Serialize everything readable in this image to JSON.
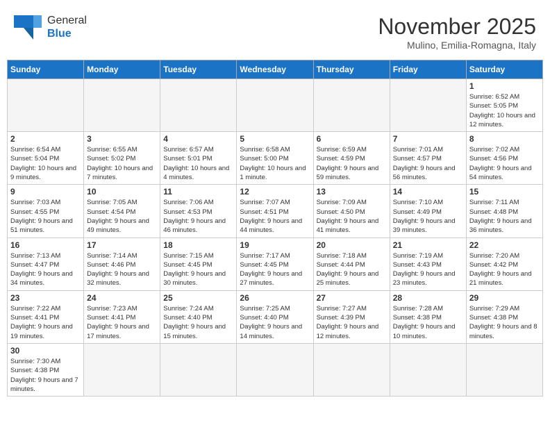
{
  "header": {
    "logo_line1": "General",
    "logo_line2": "Blue",
    "month": "November 2025",
    "location": "Mulino, Emilia-Romagna, Italy"
  },
  "weekdays": [
    "Sunday",
    "Monday",
    "Tuesday",
    "Wednesday",
    "Thursday",
    "Friday",
    "Saturday"
  ],
  "weeks": [
    [
      {
        "day": "",
        "info": ""
      },
      {
        "day": "",
        "info": ""
      },
      {
        "day": "",
        "info": ""
      },
      {
        "day": "",
        "info": ""
      },
      {
        "day": "",
        "info": ""
      },
      {
        "day": "",
        "info": ""
      },
      {
        "day": "1",
        "info": "Sunrise: 6:52 AM\nSunset: 5:05 PM\nDaylight: 10 hours and 12 minutes."
      }
    ],
    [
      {
        "day": "2",
        "info": "Sunrise: 6:54 AM\nSunset: 5:04 PM\nDaylight: 10 hours and 9 minutes."
      },
      {
        "day": "3",
        "info": "Sunrise: 6:55 AM\nSunset: 5:02 PM\nDaylight: 10 hours and 7 minutes."
      },
      {
        "day": "4",
        "info": "Sunrise: 6:57 AM\nSunset: 5:01 PM\nDaylight: 10 hours and 4 minutes."
      },
      {
        "day": "5",
        "info": "Sunrise: 6:58 AM\nSunset: 5:00 PM\nDaylight: 10 hours and 1 minute."
      },
      {
        "day": "6",
        "info": "Sunrise: 6:59 AM\nSunset: 4:59 PM\nDaylight: 9 hours and 59 minutes."
      },
      {
        "day": "7",
        "info": "Sunrise: 7:01 AM\nSunset: 4:57 PM\nDaylight: 9 hours and 56 minutes."
      },
      {
        "day": "8",
        "info": "Sunrise: 7:02 AM\nSunset: 4:56 PM\nDaylight: 9 hours and 54 minutes."
      }
    ],
    [
      {
        "day": "9",
        "info": "Sunrise: 7:03 AM\nSunset: 4:55 PM\nDaylight: 9 hours and 51 minutes."
      },
      {
        "day": "10",
        "info": "Sunrise: 7:05 AM\nSunset: 4:54 PM\nDaylight: 9 hours and 49 minutes."
      },
      {
        "day": "11",
        "info": "Sunrise: 7:06 AM\nSunset: 4:53 PM\nDaylight: 9 hours and 46 minutes."
      },
      {
        "day": "12",
        "info": "Sunrise: 7:07 AM\nSunset: 4:51 PM\nDaylight: 9 hours and 44 minutes."
      },
      {
        "day": "13",
        "info": "Sunrise: 7:09 AM\nSunset: 4:50 PM\nDaylight: 9 hours and 41 minutes."
      },
      {
        "day": "14",
        "info": "Sunrise: 7:10 AM\nSunset: 4:49 PM\nDaylight: 9 hours and 39 minutes."
      },
      {
        "day": "15",
        "info": "Sunrise: 7:11 AM\nSunset: 4:48 PM\nDaylight: 9 hours and 36 minutes."
      }
    ],
    [
      {
        "day": "16",
        "info": "Sunrise: 7:13 AM\nSunset: 4:47 PM\nDaylight: 9 hours and 34 minutes."
      },
      {
        "day": "17",
        "info": "Sunrise: 7:14 AM\nSunset: 4:46 PM\nDaylight: 9 hours and 32 minutes."
      },
      {
        "day": "18",
        "info": "Sunrise: 7:15 AM\nSunset: 4:45 PM\nDaylight: 9 hours and 30 minutes."
      },
      {
        "day": "19",
        "info": "Sunrise: 7:17 AM\nSunset: 4:45 PM\nDaylight: 9 hours and 27 minutes."
      },
      {
        "day": "20",
        "info": "Sunrise: 7:18 AM\nSunset: 4:44 PM\nDaylight: 9 hours and 25 minutes."
      },
      {
        "day": "21",
        "info": "Sunrise: 7:19 AM\nSunset: 4:43 PM\nDaylight: 9 hours and 23 minutes."
      },
      {
        "day": "22",
        "info": "Sunrise: 7:20 AM\nSunset: 4:42 PM\nDaylight: 9 hours and 21 minutes."
      }
    ],
    [
      {
        "day": "23",
        "info": "Sunrise: 7:22 AM\nSunset: 4:41 PM\nDaylight: 9 hours and 19 minutes."
      },
      {
        "day": "24",
        "info": "Sunrise: 7:23 AM\nSunset: 4:41 PM\nDaylight: 9 hours and 17 minutes."
      },
      {
        "day": "25",
        "info": "Sunrise: 7:24 AM\nSunset: 4:40 PM\nDaylight: 9 hours and 15 minutes."
      },
      {
        "day": "26",
        "info": "Sunrise: 7:25 AM\nSunset: 4:40 PM\nDaylight: 9 hours and 14 minutes."
      },
      {
        "day": "27",
        "info": "Sunrise: 7:27 AM\nSunset: 4:39 PM\nDaylight: 9 hours and 12 minutes."
      },
      {
        "day": "28",
        "info": "Sunrise: 7:28 AM\nSunset: 4:38 PM\nDaylight: 9 hours and 10 minutes."
      },
      {
        "day": "29",
        "info": "Sunrise: 7:29 AM\nSunset: 4:38 PM\nDaylight: 9 hours and 8 minutes."
      }
    ],
    [
      {
        "day": "30",
        "info": "Sunrise: 7:30 AM\nSunset: 4:38 PM\nDaylight: 9 hours and 7 minutes."
      },
      {
        "day": "",
        "info": ""
      },
      {
        "day": "",
        "info": ""
      },
      {
        "day": "",
        "info": ""
      },
      {
        "day": "",
        "info": ""
      },
      {
        "day": "",
        "info": ""
      },
      {
        "day": "",
        "info": ""
      }
    ]
  ]
}
